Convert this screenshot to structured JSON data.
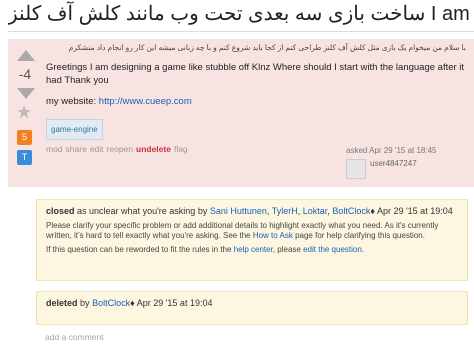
{
  "question": {
    "title_fa": "ساخت بازی سه بعدی تحت وب مانند کلش آف کلنز",
    "title_en": "I am designing a game like stubb",
    "score": "-4",
    "body_fa": "با سلام من میخوام یک بازی مثل کلش آف کلنز طراحی کنم از کجا باید شروع کنم و با چه زبانی میشه این کار رو انجام داد متشکرم",
    "body_en": "Greetings I am designing a game like stubble off Klnz Where should I start with the language after it had Thank you",
    "website_label": "my website:",
    "website_url": "http://www.cueep.com",
    "tags": [
      "game-engine"
    ],
    "badges": {
      "count": "5",
      "letter": "T"
    },
    "menu": {
      "mod": "mod",
      "share": "share",
      "edit": "edit",
      "reopen": "reopen",
      "undelete": "undelete",
      "flag": "flag"
    },
    "asked": "asked Apr 29 '15 at 18:45",
    "user": "user4847247"
  },
  "closed_notice": {
    "label": "closed",
    "reason": "as unclear what you're asking by",
    "users": [
      "Sani Huttunen",
      "TylerH",
      "Loktar",
      "BoltClock"
    ],
    "mod_suffix": "♦",
    "date": "Apr 29 '15 at",
    "time": "19:04",
    "para1_a": "Please clarify your specific problem or add additional details to highlight exactly what you need. As it's currently written, it’s hard to tell exactly what you're asking. See the",
    "how_to_ask": "How to Ask",
    "para1_b": "page for help clarifying this question.",
    "para2_a": "If this question can be reworded to fit the rules in the",
    "help_center": "help center",
    "para2_b": ", please",
    "edit_question": "edit the question",
    "para2_c": "."
  },
  "deleted_notice": {
    "label": "deleted",
    "by": "by",
    "user": "BoltClock",
    "mod_suffix": "♦",
    "date": "Apr 29 '15 at 19:04"
  },
  "add_comment": "add a comment"
}
